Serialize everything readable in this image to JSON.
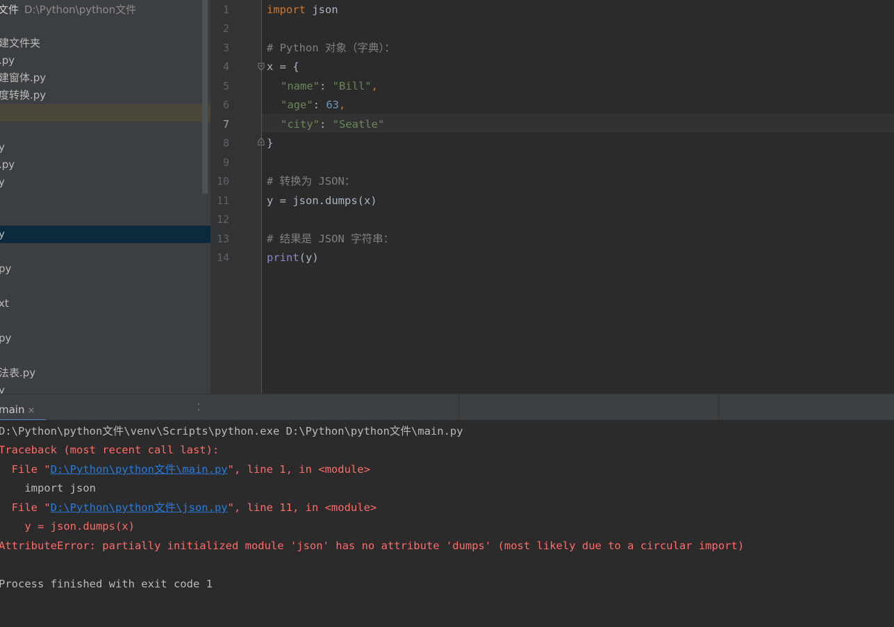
{
  "project": {
    "root_name": "文件",
    "root_path": "D:\\Python\\python文件",
    "items": [
      {
        "label": "建文件夹"
      },
      {
        "label": ".py"
      },
      {
        "label": "建窗体.py"
      },
      {
        "label": "度转换.py"
      },
      {
        "label": ""
      },
      {
        "label": ""
      },
      {
        "label": "y"
      },
      {
        "label": ".py"
      },
      {
        "label": "y"
      },
      {
        "label": ""
      },
      {
        "label": ""
      },
      {
        "label": "y"
      },
      {
        "label": ""
      },
      {
        "label": "py"
      },
      {
        "label": ""
      },
      {
        "label": "xt"
      },
      {
        "label": ""
      },
      {
        "label": "py"
      },
      {
        "label": ""
      },
      {
        "label": "法表.py"
      },
      {
        "label": "y"
      }
    ]
  },
  "editor": {
    "line_numbers": [
      "1",
      "2",
      "3",
      "4",
      "5",
      "6",
      "7",
      "8",
      "9",
      "10",
      "11",
      "12",
      "13",
      "14"
    ],
    "active_line": "7",
    "code": {
      "l1_kw": "import",
      "l1_rest": " json",
      "l3": "# Python 对象（字典）：",
      "l4": "x = {",
      "l5_key": "\"name\"",
      "l5_sep": ": ",
      "l5_val": "\"Bill\"",
      "l5_end": ",",
      "l6_key": "\"age\"",
      "l6_sep": ": ",
      "l6_val": "63",
      "l6_end": ",",
      "l7_key": "\"city\"",
      "l7_sep": ": ",
      "l7_val": "\"Seatle\"",
      "l8": "}",
      "l10": "# 转换为 JSON：",
      "l11": "y = json.dumps(x)",
      "l13": "# 结果是 JSON 字符串：",
      "l14_fn": "print",
      "l14_rest": "(y)"
    }
  },
  "run": {
    "tab_label": "main",
    "tab_close": "×",
    "command": "D:\\Python\\python文件\\venv\\Scripts\\python.exe D:\\Python\\python文件\\main.py",
    "traceback_header": "Traceback (most recent call last):",
    "frame1_prefix": "  File \"",
    "frame1_link": "D:\\Python\\python文件\\main.py",
    "frame1_suffix": "\", line 1, in <module>",
    "frame1_code": "    import json",
    "frame2_prefix": "  File \"",
    "frame2_link": "D:\\Python\\python文件\\json.py",
    "frame2_suffix": "\", line 11, in <module>",
    "frame2_code": "    y = json.dumps(x)",
    "error": "AttributeError: partially initialized module 'json' has no attribute 'dumps' (most likely due to a circular import)",
    "exit": "Process finished with exit code 1"
  },
  "colors": {
    "keyword": "#cc7832",
    "string": "#6a8759",
    "number": "#6897bb",
    "comment": "#808080",
    "error": "#ff6b68",
    "link": "#287bde"
  }
}
